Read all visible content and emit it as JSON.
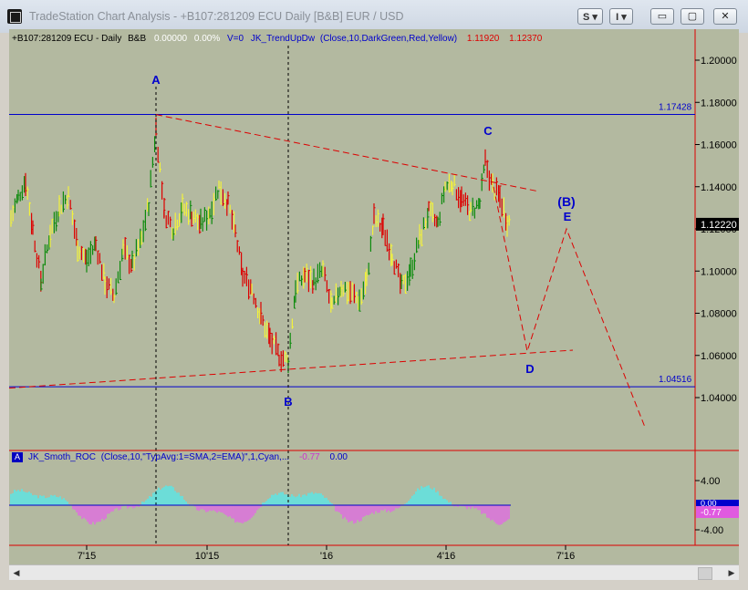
{
  "window": {
    "title": "TradeStation Chart Analysis - +B107:281209 ECU Daily [B&B] EUR / USD",
    "buttons": {
      "s": "S",
      "i": "I",
      "minimize": "▭",
      "maximize": "▢",
      "close": "✕"
    }
  },
  "legend": {
    "symbol": "+B107:281209 ECU - Daily",
    "bb": "B&B",
    "change": "0.00000",
    "pct": "0.00%",
    "v": "V=0",
    "indicator": "JK_TrendUpDw",
    "params": "(Close,10,DarkGreen,Red,Yellow)",
    "v1": "1.11920",
    "v2": "1.12370"
  },
  "sub_legend": {
    "badge": "A",
    "indicator": "JK_Smoth_ROC",
    "params": "(Close,10,\"TypAvg:1=SMA,2=EMA)\",1,Cyan,...",
    "v1": "-0.77",
    "v2": "0.00"
  },
  "price_axis": {
    "ticks": [
      "1.20000",
      "1.18000",
      "1.16000",
      "1.14000",
      "1.12000",
      "1.10000",
      "1.08000",
      "1.06000",
      "1.04000"
    ],
    "current_price": "1.12220"
  },
  "levels": {
    "upper": "1.17428",
    "lower": "1.04516"
  },
  "wave_labels": {
    "A": "A",
    "B": "B",
    "C": "C",
    "D": "D",
    "E": "E",
    "Bpar": "(B)"
  },
  "roc_axis": {
    "ticks": [
      "4.00",
      "-4.00"
    ],
    "current": "-0.77",
    "zero": "0.00"
  },
  "x_axis": {
    "ticks": [
      "7'15",
      "10'15",
      "'16",
      "4'16",
      "7'16"
    ]
  },
  "colors": {
    "bg": "#b3b9a0",
    "blue": "#0000cc",
    "red": "#dd0000",
    "green": "#0c8a0c",
    "yellow": "#f2f23c",
    "cyan": "#5ae6e6",
    "magenta": "#e06ee0"
  },
  "scroll": {
    "left": "◀",
    "right": "▶"
  }
}
